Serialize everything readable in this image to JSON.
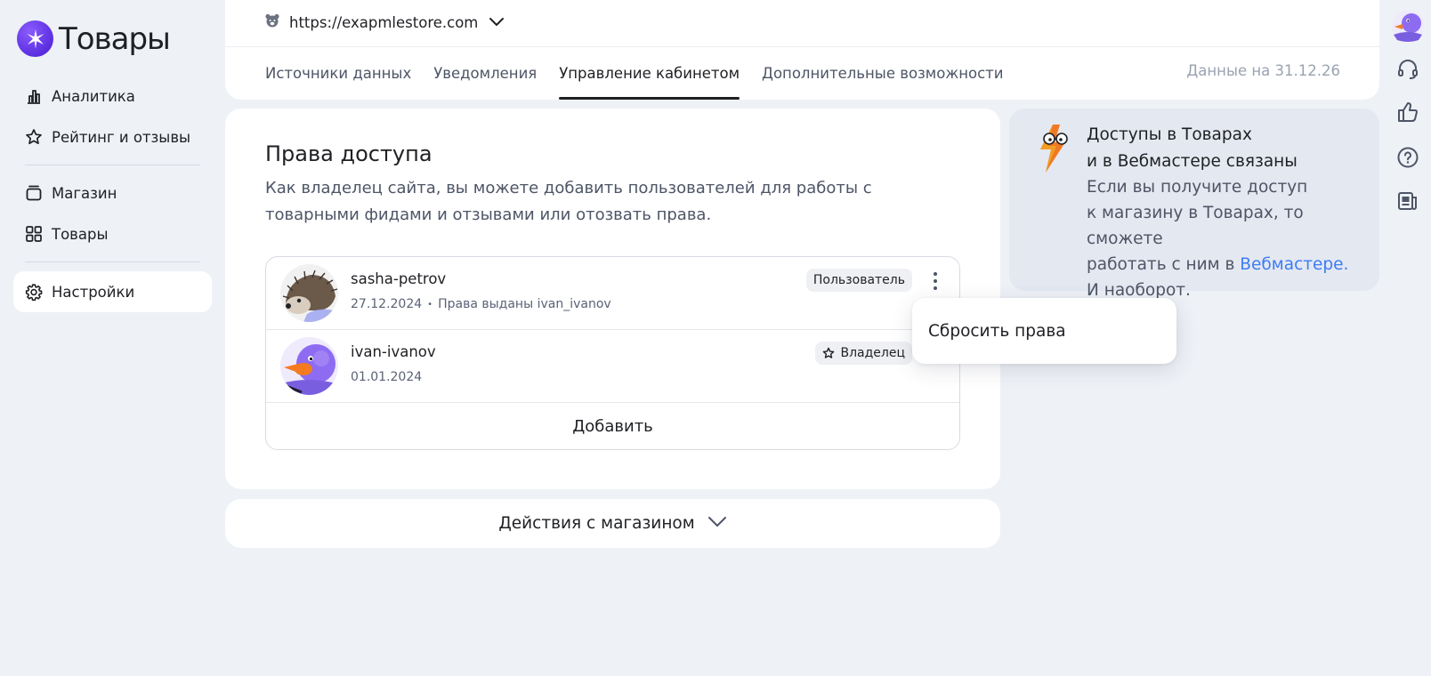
{
  "app": {
    "title": "Товары"
  },
  "sidebar": {
    "items": [
      {
        "label": "Аналитика",
        "icon": "chart-bar-icon"
      },
      {
        "label": "Рейтинг и отзывы",
        "icon": "star-icon"
      },
      {
        "label": "Магазин",
        "icon": "store-icon"
      },
      {
        "label": "Товары",
        "icon": "grid-icon"
      },
      {
        "label": "Настройки",
        "icon": "gear-icon",
        "active": true
      }
    ]
  },
  "header": {
    "site_url": "https://exapmlestore.com",
    "tabs": [
      {
        "label": "Источники данных"
      },
      {
        "label": "Уведомления"
      },
      {
        "label": "Управление кабинетом",
        "active": true
      },
      {
        "label": "Дополнительные возможности"
      }
    ],
    "data_date": "Данные на 31.12.26"
  },
  "access": {
    "title": "Права доступа",
    "description": "Как владелец сайта, вы можете добавить пользователей для работы с товарными фидами и отзывами или отозвать права.",
    "users": [
      {
        "name": "sasha-petrov",
        "date": "27.12.2024",
        "granted": "Права выданы ivan_ivanov",
        "role": "Пользователь"
      },
      {
        "name": "ivan-ivanov",
        "date": "01.01.2024",
        "role": "Владелец"
      }
    ],
    "add_label": "Добавить"
  },
  "menu": {
    "reset_label": "Сбросить права"
  },
  "actions": {
    "label": "Действия с магазином"
  },
  "info": {
    "title_line1": "Доступы в Товарах",
    "title_line2": "и в Вебмастере связаны",
    "text_line1": "Если вы получите доступ",
    "text_line2": "к магазину в Товарах, то сможете",
    "text_line3": "работать с ним в",
    "link": "Вебмастере.",
    "text_line4": "И наоборот."
  },
  "colors": {
    "accent": "#5b2ee0",
    "link": "#3d7cf5",
    "background": "#eef1f6"
  }
}
